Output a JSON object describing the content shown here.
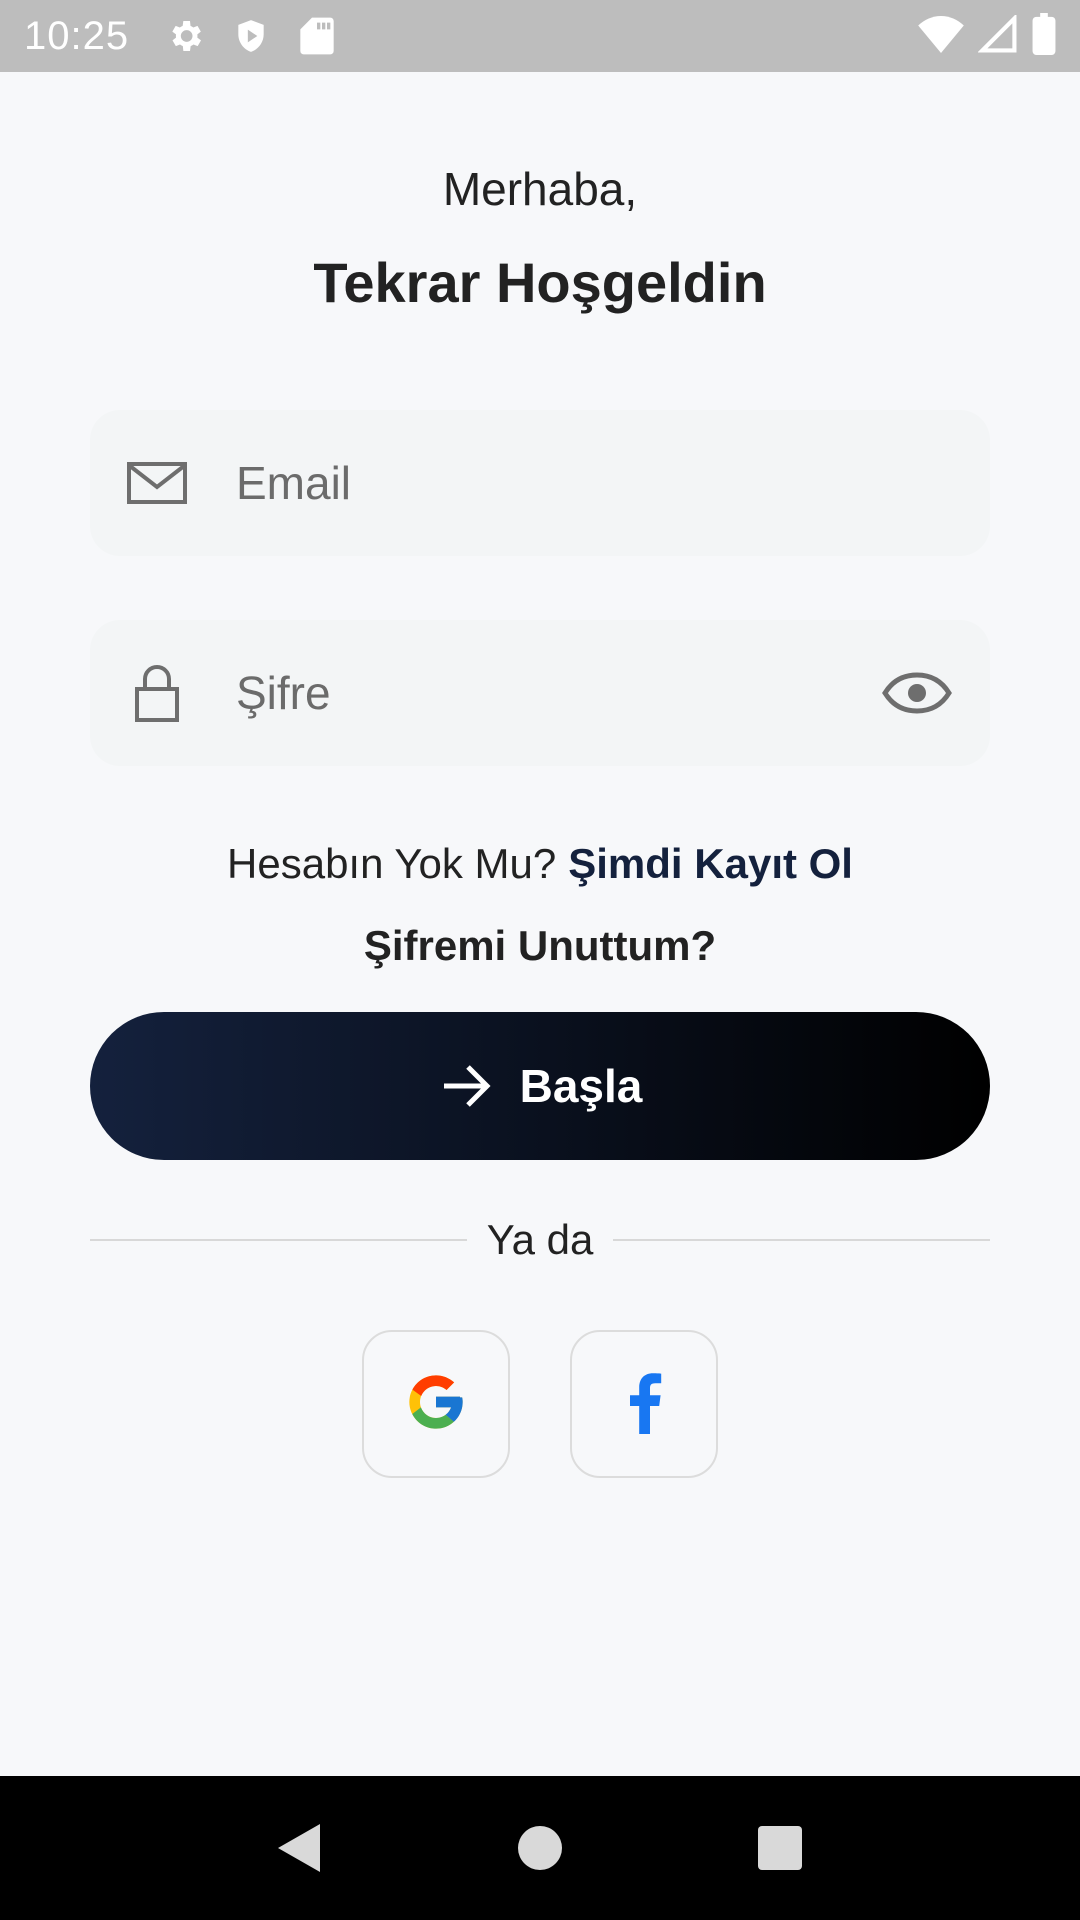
{
  "status_bar": {
    "time": "10:25",
    "icons": [
      "settings-icon",
      "shield-icon",
      "sd-card-icon",
      "wifi-icon",
      "signal-icon",
      "battery-icon"
    ]
  },
  "header": {
    "greeting": "Merhaba,",
    "title": "Tekrar Hoşgeldin"
  },
  "form": {
    "email": {
      "placeholder": "Email",
      "value": "",
      "icon": "mail-icon"
    },
    "password": {
      "placeholder": "Şifre",
      "value": "",
      "icon": "lock-icon",
      "toggle_icon": "eye-icon"
    }
  },
  "signup": {
    "prompt": "Hesabın Yok Mu?",
    "link": "Şimdi Kayıt Ol"
  },
  "forgot_password": "Şifremi Unuttum?",
  "start_button": {
    "label": "Başla",
    "icon": "arrow-right-icon"
  },
  "divider": {
    "text": "Ya da"
  },
  "social": [
    "google-icon",
    "facebook-icon"
  ],
  "colors": {
    "background": "#f7f8fa",
    "accent": "#14213d",
    "button_gradient_start": "#14213d",
    "button_gradient_end": "#000000",
    "google_blue": "#4285F4",
    "google_red": "#EA4335",
    "google_yellow": "#FBBC05",
    "google_green": "#34A853",
    "facebook_blue": "#1877F2"
  },
  "nav_bar": {
    "buttons": [
      "back-icon",
      "home-icon",
      "recents-icon"
    ]
  }
}
